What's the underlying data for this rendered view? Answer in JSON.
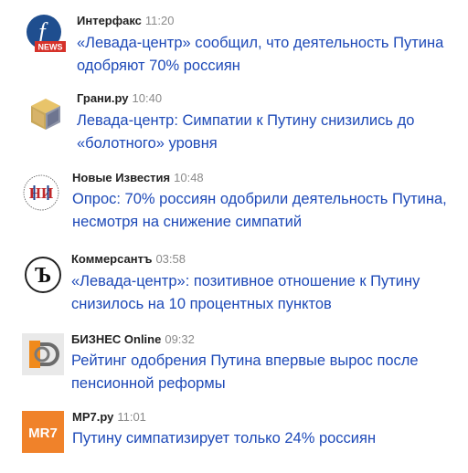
{
  "news": [
    {
      "source": "Интерфакс",
      "time": "11:20",
      "logo_icon": "interfax-news-logo",
      "logo_text": "NEWS",
      "headline_lines": [
        "«Левада-центр» сообщил, что деятельность Путина",
        "одобряют 70% россиян"
      ]
    },
    {
      "source": "Грани.ру",
      "time": "10:40",
      "logo_icon": "grani-cube-logo",
      "headline_lines": [
        "Левада-центр: Симпатии к Путину снизились до",
        "«болотного» уровня"
      ]
    },
    {
      "source": "Новые Известия",
      "time": "10:48",
      "logo_icon": "novye-izvestia-logo",
      "logo_text": "НИ",
      "headline_lines": [
        "Опрос: 70% россиян одобрили деятельность Путина,",
        "несмотря на снижение симпатий"
      ]
    },
    {
      "source": "Коммерсантъ",
      "time": "03:58",
      "logo_icon": "kommersant-logo",
      "logo_text": "Ъ",
      "headline_lines": [
        "«Левада-центр»: позитивное отношение к Путину",
        "снизилось на 10 процентных пунктов"
      ]
    },
    {
      "source": "БИЗНЕС Online",
      "time": "09:32",
      "logo_icon": "biznes-online-logo",
      "logo_text": "БО",
      "headline_lines": [
        "Рейтинг одобрения Путина впервые вырос после",
        "пенсионной реформы"
      ]
    },
    {
      "source": "МР7.ру",
      "time": "11:01",
      "logo_icon": "mr7-logo",
      "logo_text": "MR7",
      "headline_lines": [
        "Путину симпатизирует только 24% россиян"
      ]
    }
  ],
  "colors": {
    "headline": "#1e4ab8",
    "source": "#222222",
    "time": "#8a8a8a",
    "interfax_blue": "#1f4e8f",
    "interfax_red": "#d6322a",
    "mr7_orange": "#f0822a"
  }
}
